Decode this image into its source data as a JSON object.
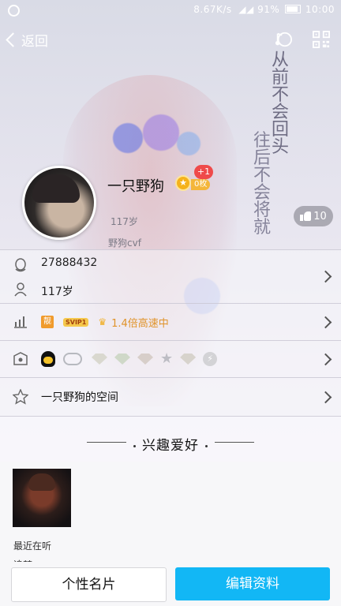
{
  "status_bar": {
    "network_speed": "8.67K/s",
    "battery": "91%",
    "time": "10:00"
  },
  "nav": {
    "back_label": "返回"
  },
  "background_poem": {
    "col1": "从前不会回头",
    "col2": "往后不会将就"
  },
  "profile": {
    "nickname": "一只野狗",
    "level_plus": "+1",
    "coin": "0枚",
    "age_sub": "117岁",
    "signature_sub": "野狗cvf",
    "likes": "10"
  },
  "info": {
    "qq_number": "27888432",
    "age": "117岁"
  },
  "vip": {
    "liang": "靓",
    "svip": "SVIP1",
    "speed": "1.4倍高速中"
  },
  "space": {
    "label": "一只野狗的空间"
  },
  "hobby": {
    "title": "兴趣爱好",
    "recent_label": "最近在听",
    "song": "追梦"
  },
  "footer": {
    "card_button": "个性名片",
    "edit_button": "编辑资料"
  },
  "colors": {
    "accent": "#12b7f5",
    "badge_red": "#ef4a4a",
    "gold": "#f4b63a"
  }
}
